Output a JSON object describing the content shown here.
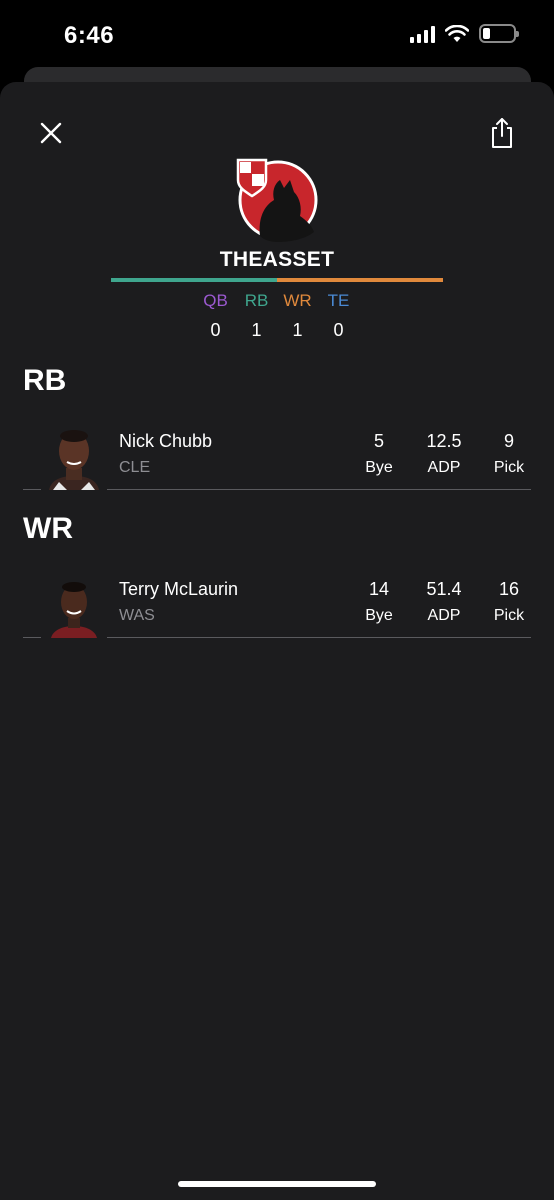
{
  "status_bar": {
    "time": "6:46",
    "battery_level": 0.25
  },
  "header": {
    "team_name": "THEASSET"
  },
  "position_summary": [
    {
      "label": "QB",
      "count": "0",
      "color": "#9b59d0"
    },
    {
      "label": "RB",
      "count": "1",
      "color": "#3fa68e"
    },
    {
      "label": "WR",
      "count": "1",
      "color": "#e0893c"
    },
    {
      "label": "TE",
      "count": "0",
      "color": "#4a8ad4"
    }
  ],
  "position_bar_split": {
    "RB": 0.5,
    "WR": 0.5
  },
  "sections": [
    {
      "title": "RB",
      "players": [
        {
          "name": "Nick Chubb",
          "team": "CLE",
          "bye": "5",
          "adp": "12.5",
          "pick": "9"
        }
      ]
    },
    {
      "title": "WR",
      "players": [
        {
          "name": "Terry McLaurin",
          "team": "WAS",
          "bye": "14",
          "adp": "51.4",
          "pick": "16"
        }
      ]
    }
  ],
  "stat_labels": {
    "bye": "Bye",
    "adp": "ADP",
    "pick": "Pick"
  },
  "colors": {
    "logo_red": "#c8262c",
    "sheet_bg": "#1c1c1e"
  }
}
